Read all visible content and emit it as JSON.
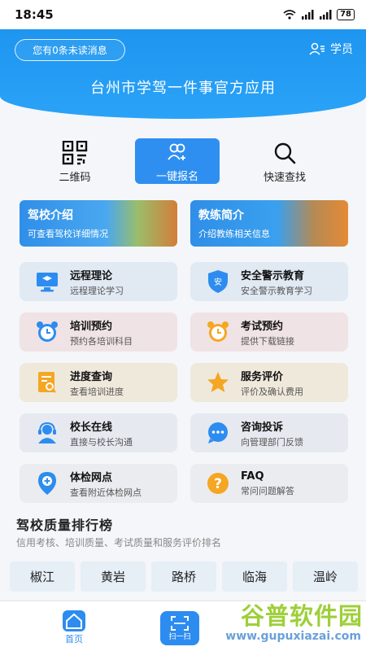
{
  "status": {
    "time": "18:45",
    "battery": "78"
  },
  "header": {
    "unread": "您有0条未读消息",
    "role": "学员",
    "title": "台州市学驾一件事官方应用"
  },
  "quick": {
    "qr_label": "二维码",
    "signup_label": "一键报名",
    "search_label": "快速查找"
  },
  "banners": [
    {
      "title": "驾校介绍",
      "subtitle": "可查看驾校详细情况"
    },
    {
      "title": "教练简介",
      "subtitle": "介绍教练相关信息"
    }
  ],
  "services": [
    {
      "title": "远程理论",
      "subtitle": "远程理论学习",
      "icon": "monitor-icon"
    },
    {
      "title": "安全警示教育",
      "subtitle": "安全警示教育学习",
      "icon": "shield-icon"
    },
    {
      "title": "培训预约",
      "subtitle": "预约各培训科目",
      "icon": "alarm-clock-icon"
    },
    {
      "title": "考试预约",
      "subtitle": "提供下载链接",
      "icon": "alarm-clock-icon"
    },
    {
      "title": "进度查询",
      "subtitle": "查看培训进度",
      "icon": "document-search-icon"
    },
    {
      "title": "服务评价",
      "subtitle": "评价及确认费用",
      "icon": "star-icon"
    },
    {
      "title": "校长在线",
      "subtitle": "直接与校长沟通",
      "icon": "headset-icon"
    },
    {
      "title": "咨询投诉",
      "subtitle": "向管理部门反馈",
      "icon": "chat-icon"
    },
    {
      "title": "体检网点",
      "subtitle": "查看附近体检网点",
      "icon": "location-pin-icon"
    },
    {
      "title": "FAQ",
      "subtitle": "常问问题解答",
      "icon": "question-icon"
    }
  ],
  "ranking": {
    "title": "驾校质量排行榜",
    "subtitle": "信用考核、培训质量、考试质量和服务评价排名",
    "cities": [
      "椒江",
      "黄岩",
      "路桥",
      "临海",
      "温岭"
    ]
  },
  "tabbar": {
    "home": "首页",
    "scan": "扫一扫"
  },
  "watermark": {
    "main": "谷普软件园",
    "url": "www.gupuxiazai.com"
  },
  "colors": {
    "primary": "#2d8cf0",
    "orange": "#f5a623"
  }
}
